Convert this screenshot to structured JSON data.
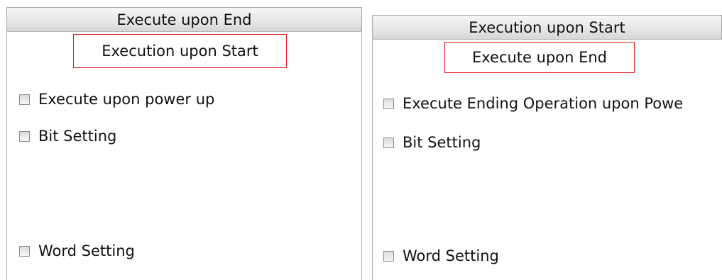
{
  "left": {
    "tab_label": "Execute upon End",
    "highlight_label": "Execution upon Start",
    "options": {
      "power_up": "Execute upon power up",
      "bit_setting": "Bit Setting",
      "word_setting": "Word Setting"
    }
  },
  "right": {
    "tab_label": "Execution upon Start",
    "highlight_label": "Execute upon End",
    "options": {
      "power_up": "Execute Ending Operation upon Powe",
      "bit_setting": "Bit Setting",
      "word_setting": "Word Setting"
    }
  },
  "colors": {
    "highlight_border": "#e21b1b",
    "tab_gradient_top": "#f6f6f6",
    "tab_gradient_bottom": "#d6d6d6",
    "panel_border": "#a9a9a9"
  }
}
